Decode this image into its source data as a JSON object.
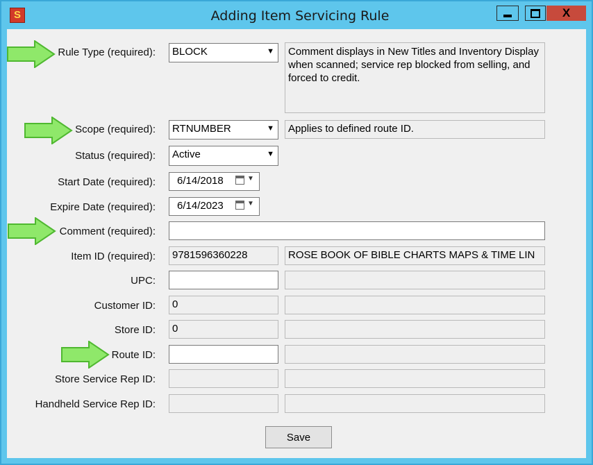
{
  "window": {
    "title": "Adding Item Servicing Rule",
    "close_label": "X",
    "app_icon_glyph": "S"
  },
  "form": {
    "rule_type": {
      "label": "Rule Type (required):",
      "value": "BLOCK",
      "description": "Comment displays in New Titles and Inventory Display when scanned; service rep blocked from selling, and forced to credit."
    },
    "scope": {
      "label": "Scope (required):",
      "value": "RTNUMBER",
      "description": "Applies to defined route ID."
    },
    "status": {
      "label": "Status (required):",
      "value": "Active"
    },
    "start_date": {
      "label": "Start Date (required):",
      "value": "6/14/2018"
    },
    "expire_date": {
      "label": "Expire Date (required):",
      "value": "6/14/2023"
    },
    "comment": {
      "label": "Comment (required):",
      "value": ""
    },
    "item_id": {
      "label": "Item ID (required):",
      "value": "9781596360228",
      "description": "ROSE BOOK OF BIBLE CHARTS MAPS & TIME LIN"
    },
    "upc": {
      "label": "UPC:",
      "value": "",
      "description": ""
    },
    "customer_id": {
      "label": "Customer ID:",
      "value": "0",
      "description": ""
    },
    "store_id": {
      "label": "Store ID:",
      "value": "0",
      "description": ""
    },
    "route_id": {
      "label": "Route ID:",
      "value": "",
      "description": ""
    },
    "store_service_rep_id": {
      "label": "Store Service Rep ID:",
      "value": "",
      "description": ""
    },
    "handheld_service_rep_id": {
      "label": "Handheld Service Rep ID:",
      "value": "",
      "description": ""
    }
  },
  "save_label": "Save",
  "icons": {
    "dropdown": "chevron-down-icon",
    "calendar": "calendar-icon",
    "arrow": "green-arrow-icon"
  },
  "colors": {
    "title_bar": "#5ec6ec",
    "close_button": "#c74a3c",
    "arrow_fill": "#8fe86a",
    "arrow_stroke": "#4fb830"
  }
}
